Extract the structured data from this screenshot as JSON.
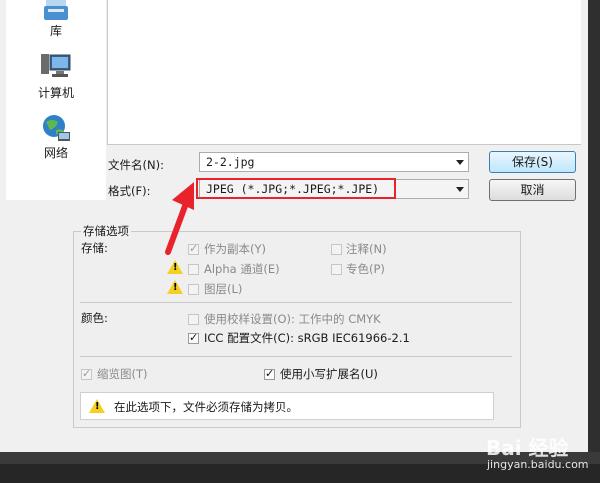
{
  "places": {
    "library": "库",
    "computer": "计算机",
    "network": "网络"
  },
  "form": {
    "filename_label": "文件名(N):",
    "filename_value": "2-2.jpg",
    "format_label": "格式(F):",
    "format_value": "JPEG (*.JPG;*.JPEG;*.JPE)",
    "save_button": "保存(S)",
    "cancel_button": "取消"
  },
  "options": {
    "group_title": "存储选项",
    "store_label": "存储:",
    "as_copy": "作为副本(Y)",
    "annotations": "注释(N)",
    "alpha": "Alpha 通道(E)",
    "spot": "专色(P)",
    "layers": "图层(L)",
    "color_label": "颜色:",
    "proof_setup": "使用校样设置(O): 工作中的 CMYK",
    "icc_profile": "ICC 配置文件(C): sRGB IEC61966-2.1",
    "thumbnail": "缩览图(T)",
    "lowercase_ext": "使用小写扩展名(U)",
    "notice": "在此选项下，文件必须存储为拷贝。"
  },
  "states": {
    "as_copy_checked": true,
    "annotations_checked": false,
    "alpha_checked": false,
    "spot_checked": false,
    "layers_checked": false,
    "proof_setup_checked": false,
    "icc_profile_checked": true,
    "thumbnail_checked": true,
    "lowercase_ext_checked": true
  },
  "watermark": {
    "brand": "Bai 经验",
    "url": "jingyan.baidu.com"
  },
  "colors": {
    "highlight": "#e8232b",
    "warning": "#f5d020",
    "default_button": "#3c7fb1"
  }
}
